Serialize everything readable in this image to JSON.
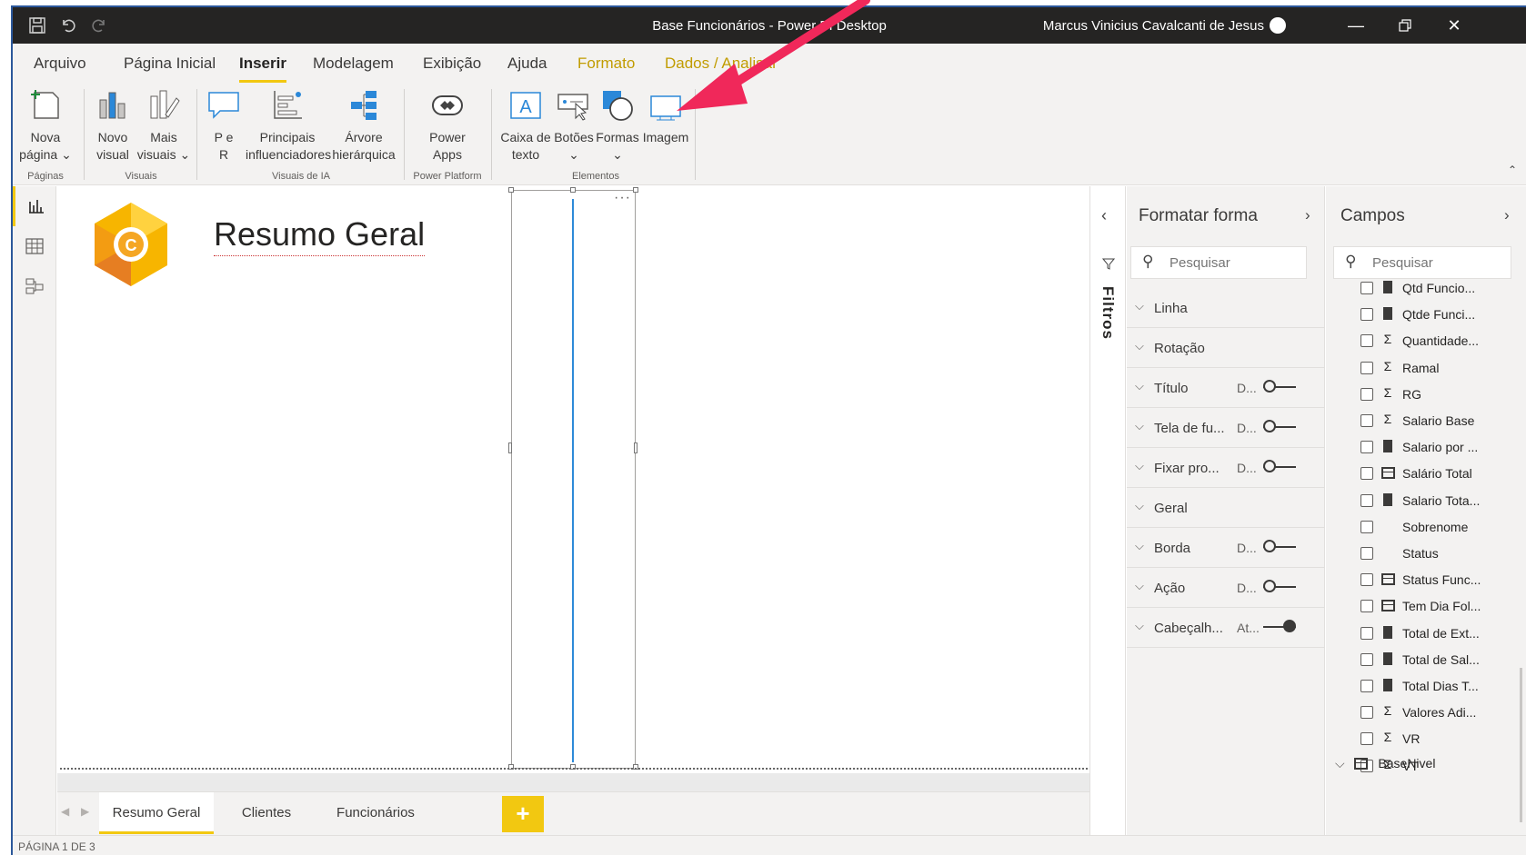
{
  "window": {
    "title": "Base Funcionários - Power BI Desktop",
    "user": "Marcus Vinicius Cavalcanti de Jesus"
  },
  "tabs": [
    "Arquivo",
    "Página Inicial",
    "Inserir",
    "Modelagem",
    "Exibição",
    "Ajuda",
    "Formato",
    "Dados / Analisar"
  ],
  "ribbon": {
    "buttons": {
      "nova_pagina": [
        "Nova",
        "página ⌄"
      ],
      "novo_visual": [
        "Novo",
        "visual"
      ],
      "mais_visuais": [
        "Mais",
        "visuais ⌄"
      ],
      "pe_r": [
        "P e",
        "R"
      ],
      "principais": [
        "Principais",
        "influenciadores"
      ],
      "arvore": [
        "Árvore",
        "hierárquica"
      ],
      "power_apps": [
        "Power",
        "Apps"
      ],
      "caixa_texto": [
        "Caixa de",
        "texto"
      ],
      "botoes": [
        "Botões",
        "⌄"
      ],
      "formas": [
        "Formas",
        "⌄"
      ],
      "imagem": [
        "Imagem",
        ""
      ]
    },
    "groups": [
      "Páginas",
      "Visuais",
      "Visuais de IA",
      "Power Platform",
      "Elementos"
    ]
  },
  "report": {
    "title": "Resumo Geral"
  },
  "page_tabs": [
    "Resumo Geral",
    "Clientes",
    "Funcionários"
  ],
  "add_page_label": "+",
  "status": "PÁGINA 1 DE 3",
  "filters_label": "Filtros",
  "format_pane": {
    "title": "Formatar forma",
    "search_placeholder": "Pesquisar",
    "rows": [
      {
        "label": "Linha",
        "value": "",
        "toggle": null
      },
      {
        "label": "Rotação",
        "value": "",
        "toggle": null
      },
      {
        "label": "Título",
        "value": "D...",
        "toggle": "off"
      },
      {
        "label": "Tela de fu...",
        "value": "D...",
        "toggle": "off"
      },
      {
        "label": "Fixar pro...",
        "value": "D...",
        "toggle": "off"
      },
      {
        "label": "Geral",
        "value": "",
        "toggle": null
      },
      {
        "label": "Borda",
        "value": "D...",
        "toggle": "off"
      },
      {
        "label": "Ação",
        "value": "D...",
        "toggle": "off"
      },
      {
        "label": "Cabeçalh...",
        "value": "At...",
        "toggle": "on"
      }
    ]
  },
  "fields_pane": {
    "title": "Campos",
    "search_placeholder": "Pesquisar",
    "fields": [
      {
        "name": "Qtd Funcio...",
        "type": "calc"
      },
      {
        "name": "Qtde Funci...",
        "type": "calc"
      },
      {
        "name": "Quantidade...",
        "type": "sum"
      },
      {
        "name": "Ramal",
        "type": "sum"
      },
      {
        "name": "RG",
        "type": "sum"
      },
      {
        "name": "Salario Base",
        "type": "sum"
      },
      {
        "name": "Salario por ...",
        "type": "calc"
      },
      {
        "name": "Salário Total",
        "type": "table"
      },
      {
        "name": "Salario Tota...",
        "type": "calc"
      },
      {
        "name": "Sobrenome",
        "type": "none"
      },
      {
        "name": "Status",
        "type": "none"
      },
      {
        "name": "Status Func...",
        "type": "table"
      },
      {
        "name": "Tem Dia Fol...",
        "type": "table"
      },
      {
        "name": "Total de Ext...",
        "type": "calc"
      },
      {
        "name": "Total de Sal...",
        "type": "calc"
      },
      {
        "name": "Total Dias T...",
        "type": "calc"
      },
      {
        "name": "Valores Adi...",
        "type": "sum"
      },
      {
        "name": "VR",
        "type": "sum"
      },
      {
        "name": "VT",
        "type": "sum"
      }
    ],
    "table_group": "BaseNivel"
  },
  "colors": {
    "accent": "#f2c811",
    "title_bar": "#252423",
    "shape_line": "#2e8ad8",
    "annotation_arrow": "#f0285a"
  }
}
